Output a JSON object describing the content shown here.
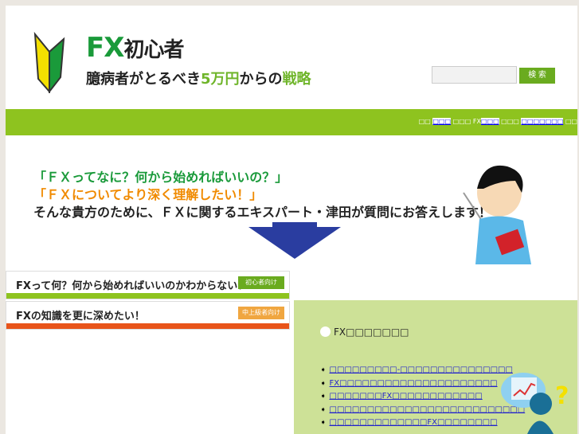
{
  "header": {
    "logo_title": "FX",
    "logo_title_jp": "初心者",
    "logo_sub_a": "臆病者がとるべき",
    "logo_sub_b": "5万円",
    "logo_sub_c": "からの",
    "logo_sub_d": "戦略",
    "search_placeholder": "",
    "search_button": "検 索"
  },
  "nav": {
    "items": [
      {
        "text": "□□ ",
        "link": false
      },
      {
        "text": "□□□",
        "link": true
      },
      {
        "text": " □□□ FX",
        "link": false
      },
      {
        "text": "□□□",
        "link": true
      },
      {
        "text": " □□□ ",
        "link": false
      },
      {
        "text": "□□□□□□□",
        "link": true
      },
      {
        "text": " □□",
        "link": false
      }
    ]
  },
  "hero": {
    "line1": "「ＦＸってなに？何から始めればいいの？」",
    "line2": "「ＦＸについてより深く理解したい！」",
    "line3": "そんな貴方のために、ＦＸに関するエキスパート・津田が質問にお答えします！"
  },
  "panels": [
    {
      "title": "FXって何？何から始めればいいのかわからない！",
      "badge": "初心者向け",
      "color": "#8ec31f",
      "badge_color": "#6aab1f"
    },
    {
      "title": "FXの知識を更に深めたい！",
      "badge": "中上級者向け",
      "color": "#e8541a",
      "badge_color": "#f0a640"
    }
  ],
  "side": {
    "heading": "FX□□□□□□□",
    "links": [
      "□□□□□□□□□-□□□□□□□□□□□□□□□",
      "FX□□□□□□□□□□□□□□□□□□□□□",
      "□□□□□□□FX□□□□□□□□□□□□",
      "□□□□□□□□□□□□□□□□□□□□□□□□□□",
      "□□□□□□□□□□□□□FX□□□□□□□□"
    ]
  }
}
